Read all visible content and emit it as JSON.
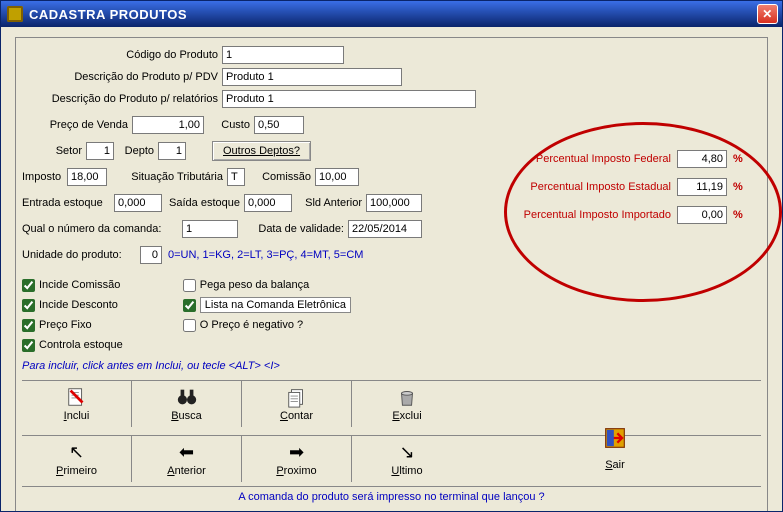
{
  "window": {
    "title": "CADASTRA PRODUTOS"
  },
  "labels": {
    "codigo": "Código do Produto",
    "descr_pdv": "Descrição do Produto p/ PDV",
    "descr_rel": "Descrição do Produto p/ relatórios",
    "preco_venda": "Preço de Venda",
    "custo": "Custo",
    "setor": "Setor",
    "depto": "Depto",
    "outros_deptos": "Outros Deptos?",
    "imposto": "Imposto",
    "sit_trib": "Situação Tributária",
    "comissao": "Comissão",
    "entrada_estoque": "Entrada estoque",
    "saida_estoque": "Saída estoque",
    "sld_anterior": "Sld Anterior",
    "num_comanda": "Qual o número da comanda:",
    "data_validade": "Data de validade:",
    "unidade_produto": "Unidade do produto:",
    "unidade_legend": "0=UN, 1=KG, 2=LT, 3=PÇ, 4=MT, 5=CM"
  },
  "values": {
    "codigo": "1",
    "descr_pdv": "Produto 1",
    "descr_rel": "Produto 1",
    "preco_venda": "1,00",
    "custo": "0,50",
    "setor": "1",
    "depto": "1",
    "imposto": "18,00",
    "sit_trib": "T",
    "comissao": "10,00",
    "entrada_estoque": "0,000",
    "saida_estoque": "0,000",
    "sld_anterior": "100,000",
    "num_comanda": "1",
    "data_validade": "22/05/2014",
    "unidade_produto": "0"
  },
  "checks": {
    "incide_comissao": {
      "label": "Incide Comissão",
      "checked": true
    },
    "incide_desconto": {
      "label": "Incide Desconto",
      "checked": true
    },
    "preco_fixo": {
      "label": "Preço Fixo",
      "checked": true
    },
    "controla_estoque": {
      "label": "Controla estoque",
      "checked": true
    },
    "pega_peso": {
      "label": "Pega peso da balança",
      "checked": false
    },
    "lista_comanda": {
      "label": "Lista na Comanda Eletrônica",
      "checked": true
    },
    "preco_negativo": {
      "label": "O Preço é negativo ?",
      "checked": false
    }
  },
  "tax": {
    "federal": {
      "label": "Percentual Imposto Federal",
      "value": "4,80",
      "pct": "%"
    },
    "estadual": {
      "label": "Percentual Imposto Estadual",
      "value": "11,19",
      "pct": "%"
    },
    "importado": {
      "label": "Percentual Imposto Importado",
      "value": "0,00",
      "pct": "%"
    }
  },
  "hint": "Para incluir, click antes em Inclui, ou tecle <ALT> <I>",
  "toolbar": {
    "inclui": "Inclui",
    "busca": "Busca",
    "contar": "Contar",
    "exclui": "Exclui",
    "primeiro": "Primeiro",
    "anterior": "Anterior",
    "proximo": "Proximo",
    "ultimo": "Ultimo",
    "sair": "Sair"
  },
  "footer": "A comanda do produto será impresso no terminal que lançou ?"
}
